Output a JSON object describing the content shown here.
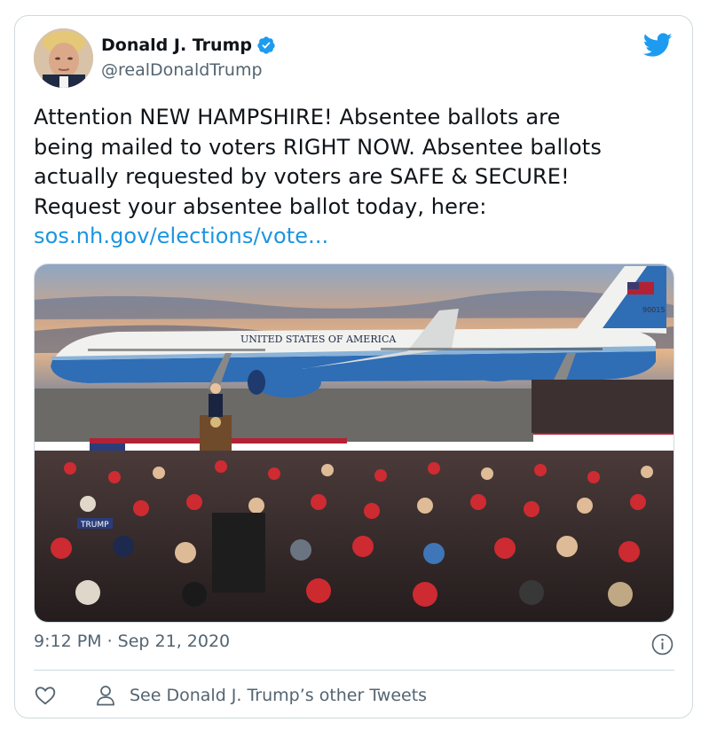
{
  "tweet": {
    "display_name": "Donald J. Trump",
    "handle": "@realDonaldTrump",
    "text_lines": [
      "Attention NEW HAMPSHIRE! Absentee ballots are",
      "being mailed to voters RIGHT NOW. Absentee ballots",
      "actually requested by voters are SAFE & SECURE!",
      "Request your absentee ballot today, here:"
    ],
    "link": "sos.nh.gov/elections/vote...",
    "timestamp": "9:12 PM · Sep 21, 2020",
    "other_tweets_label": "See Donald J. Trump’s other Tweets"
  },
  "media": {
    "plane_fuselage_text": "UNITED STATES OF AMERICA",
    "tail_number": "90015",
    "sign_text": "TRUMP"
  },
  "colors": {
    "link": "#1b95e0",
    "verified": "#1d9bf0",
    "secondary_text": "#536471",
    "border": "#cfd9de"
  },
  "icons": [
    "verified-badge-icon",
    "twitter-bird-icon",
    "info-icon",
    "heart-icon",
    "person-icon"
  ]
}
